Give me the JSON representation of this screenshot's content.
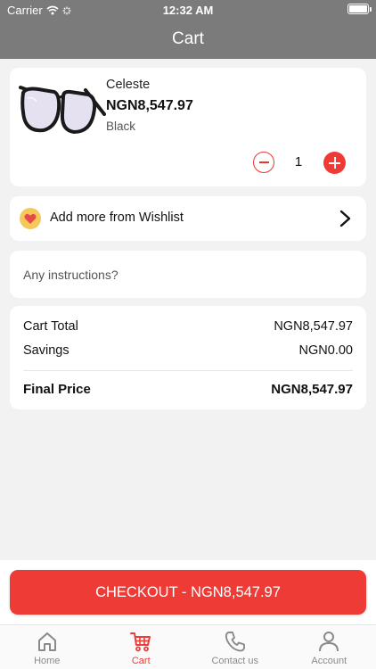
{
  "status_bar": {
    "carrier": "Carrier",
    "time": "12:32 AM"
  },
  "nav": {
    "title": "Cart"
  },
  "cart_item": {
    "name": "Celeste",
    "price": "NGN8,547.97",
    "color": "Black",
    "quantity": "1"
  },
  "wishlist": {
    "label": "Add more from Wishlist"
  },
  "instructions": {
    "placeholder": "Any instructions?"
  },
  "totals": {
    "cart_total_label": "Cart Total",
    "cart_total_value": "NGN8,547.97",
    "savings_label": "Savings",
    "savings_value": "NGN0.00",
    "final_label": "Final Price",
    "final_value": "NGN8,547.97"
  },
  "checkout": {
    "label": "CHECKOUT - NGN8,547.97"
  },
  "tabs": [
    {
      "label": "Home",
      "icon": "home-icon"
    },
    {
      "label": "Cart",
      "icon": "cart-icon"
    },
    {
      "label": "Contact us",
      "icon": "phone-icon"
    },
    {
      "label": "Account",
      "icon": "account-icon"
    }
  ],
  "colors": {
    "accent": "#ef3b36",
    "header": "#7b7b7b",
    "background": "#f2f2f2"
  }
}
